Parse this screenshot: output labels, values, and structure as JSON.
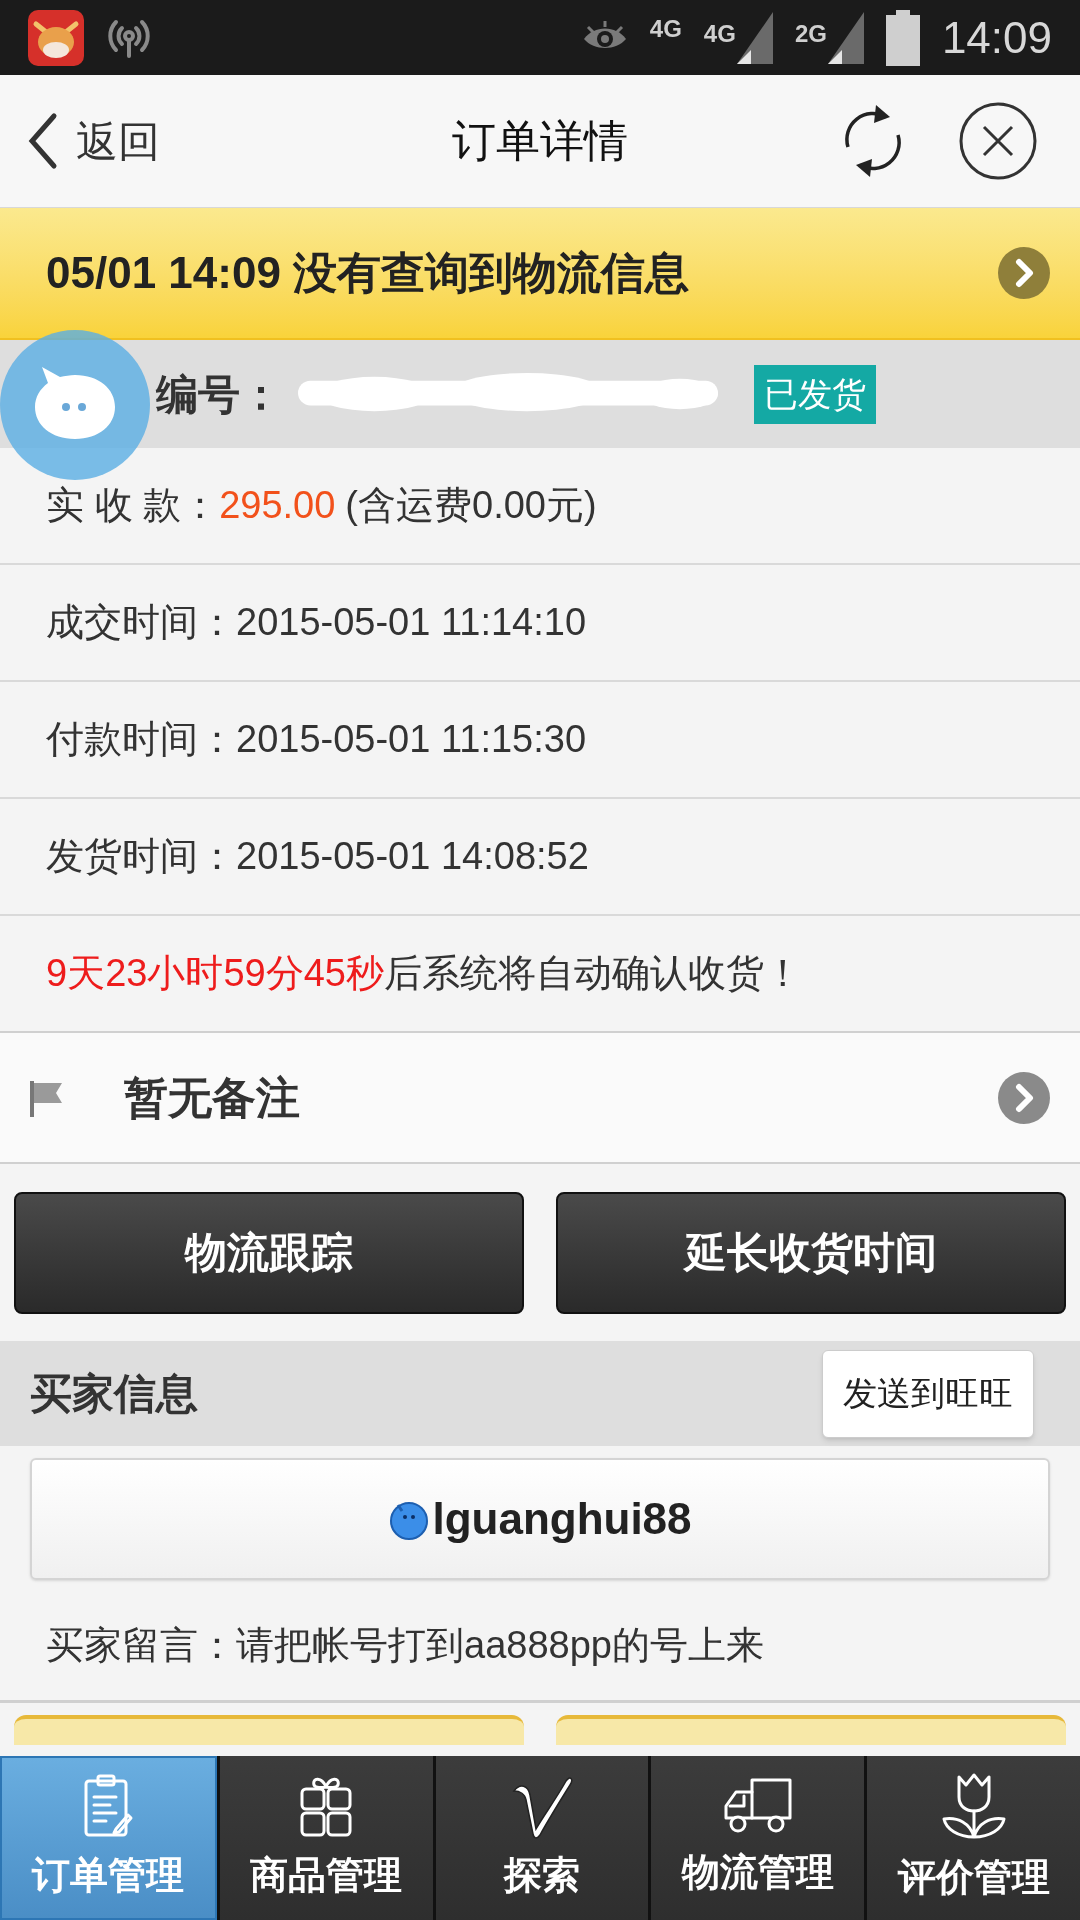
{
  "status_bar": {
    "network_labels": [
      "4G",
      "4G",
      "2G"
    ],
    "time": "14:09"
  },
  "header": {
    "back": "返回",
    "title": "订单详情"
  },
  "logistics_banner": {
    "text": "05/01 14:09 没有查询到物流信息"
  },
  "order": {
    "number_label": "编号：",
    "status": "已发货"
  },
  "amount": {
    "label": "实 收 款：",
    "value": "295.00",
    "note": "(含运费0.00元)"
  },
  "times": [
    {
      "label": "成交时间：",
      "value": "2015-05-01 11:14:10"
    },
    {
      "label": "付款时间：",
      "value": "2015-05-01 11:15:30"
    },
    {
      "label": "发货时间：",
      "value": "2015-05-01 14:08:52"
    }
  ],
  "auto_confirm": {
    "countdown": "9天23小时59分45秒",
    "message": "后系统将自动确认收货！"
  },
  "remark": {
    "text": "暂无备注"
  },
  "actions": [
    "物流跟踪",
    "延长收货时间"
  ],
  "buyer": {
    "section_title": "买家信息",
    "send_button": "发送到旺旺",
    "name": "lguanghui88",
    "message": "买家留言：请把帐号打到aa888pp的号上来"
  },
  "nav": [
    {
      "label": "订单管理",
      "selected": true
    },
    {
      "label": "商品管理",
      "selected": false
    },
    {
      "label": "探索",
      "selected": false
    },
    {
      "label": "物流管理",
      "selected": false
    },
    {
      "label": "评价管理",
      "selected": false
    }
  ]
}
